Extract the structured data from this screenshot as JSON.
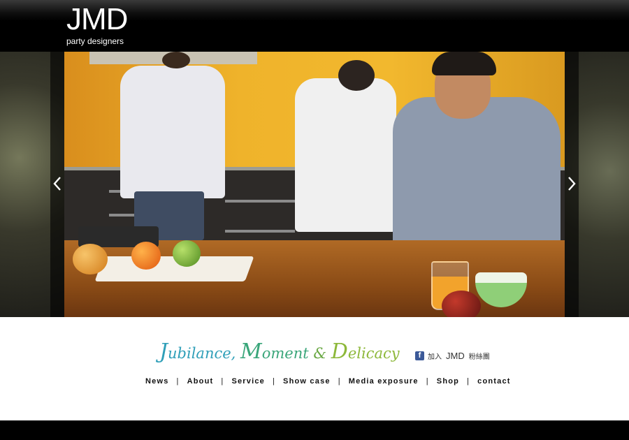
{
  "header": {
    "logo_main": "JMD",
    "logo_sub": "party designers"
  },
  "slideshow": {
    "prev_icon": "chevron-left-icon",
    "next_icon": "chevron-right-icon"
  },
  "tagline": {
    "j": "J",
    "word1": "ubilance,",
    "m": "M",
    "word2": "oment",
    "amp": "&",
    "d": "D",
    "word3": "elicacy"
  },
  "facebook": {
    "icon": "facebook-icon",
    "label": "加入",
    "brand": "JMD",
    "suffix": "粉絲團"
  },
  "nav": {
    "items": [
      "News",
      "About",
      "Service",
      "Show case",
      "Media exposure",
      "Shop",
      "contact"
    ],
    "separator": "|"
  },
  "colors": {
    "header_bg": "#000000",
    "footer_bg": "#000000",
    "tag_blue": "#2f9fb8",
    "tag_green": "#3aa67a",
    "tag_lime": "#8db83a",
    "facebook_blue": "#3b5998"
  }
}
